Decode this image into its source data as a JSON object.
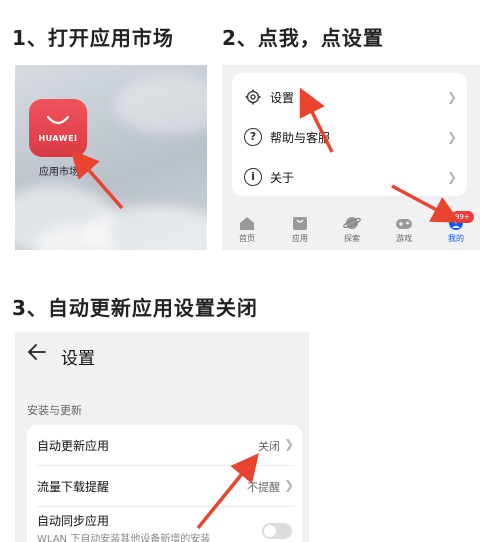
{
  "steps": {
    "step1": "1、打开应用市场",
    "step2": "2、点我，点设置",
    "step3": "3、自动更新应用设置关闭"
  },
  "panel1": {
    "app_icon_text": "HUAWEI",
    "app_label": "应用市场",
    "brand_color": "#e8434d"
  },
  "panel2": {
    "menu": [
      {
        "label": "设置",
        "icon": "gear-icon"
      },
      {
        "label": "帮助与客服",
        "icon": "help-icon"
      },
      {
        "label": "关于",
        "icon": "info-icon"
      }
    ],
    "nav": [
      {
        "label": "首页",
        "icon": "home-icon"
      },
      {
        "label": "应用",
        "icon": "apps-icon"
      },
      {
        "label": "探索",
        "icon": "planet-icon"
      },
      {
        "label": "游戏",
        "icon": "gamepad-icon"
      },
      {
        "label": "我的",
        "icon": "profile-icon"
      }
    ],
    "badge": "99+",
    "active_color": "#0a59f7"
  },
  "panel3": {
    "title": "设置",
    "section_header": "安装与更新",
    "rows": [
      {
        "label": "自动更新应用",
        "value": "关闭"
      },
      {
        "label": "流量下载提醒",
        "value": "不提醒"
      },
      {
        "label": "自动同步应用",
        "sub": "WLAN 下自动安装其他设备新增的安装"
      }
    ]
  },
  "arrow_color": "#e8442f"
}
